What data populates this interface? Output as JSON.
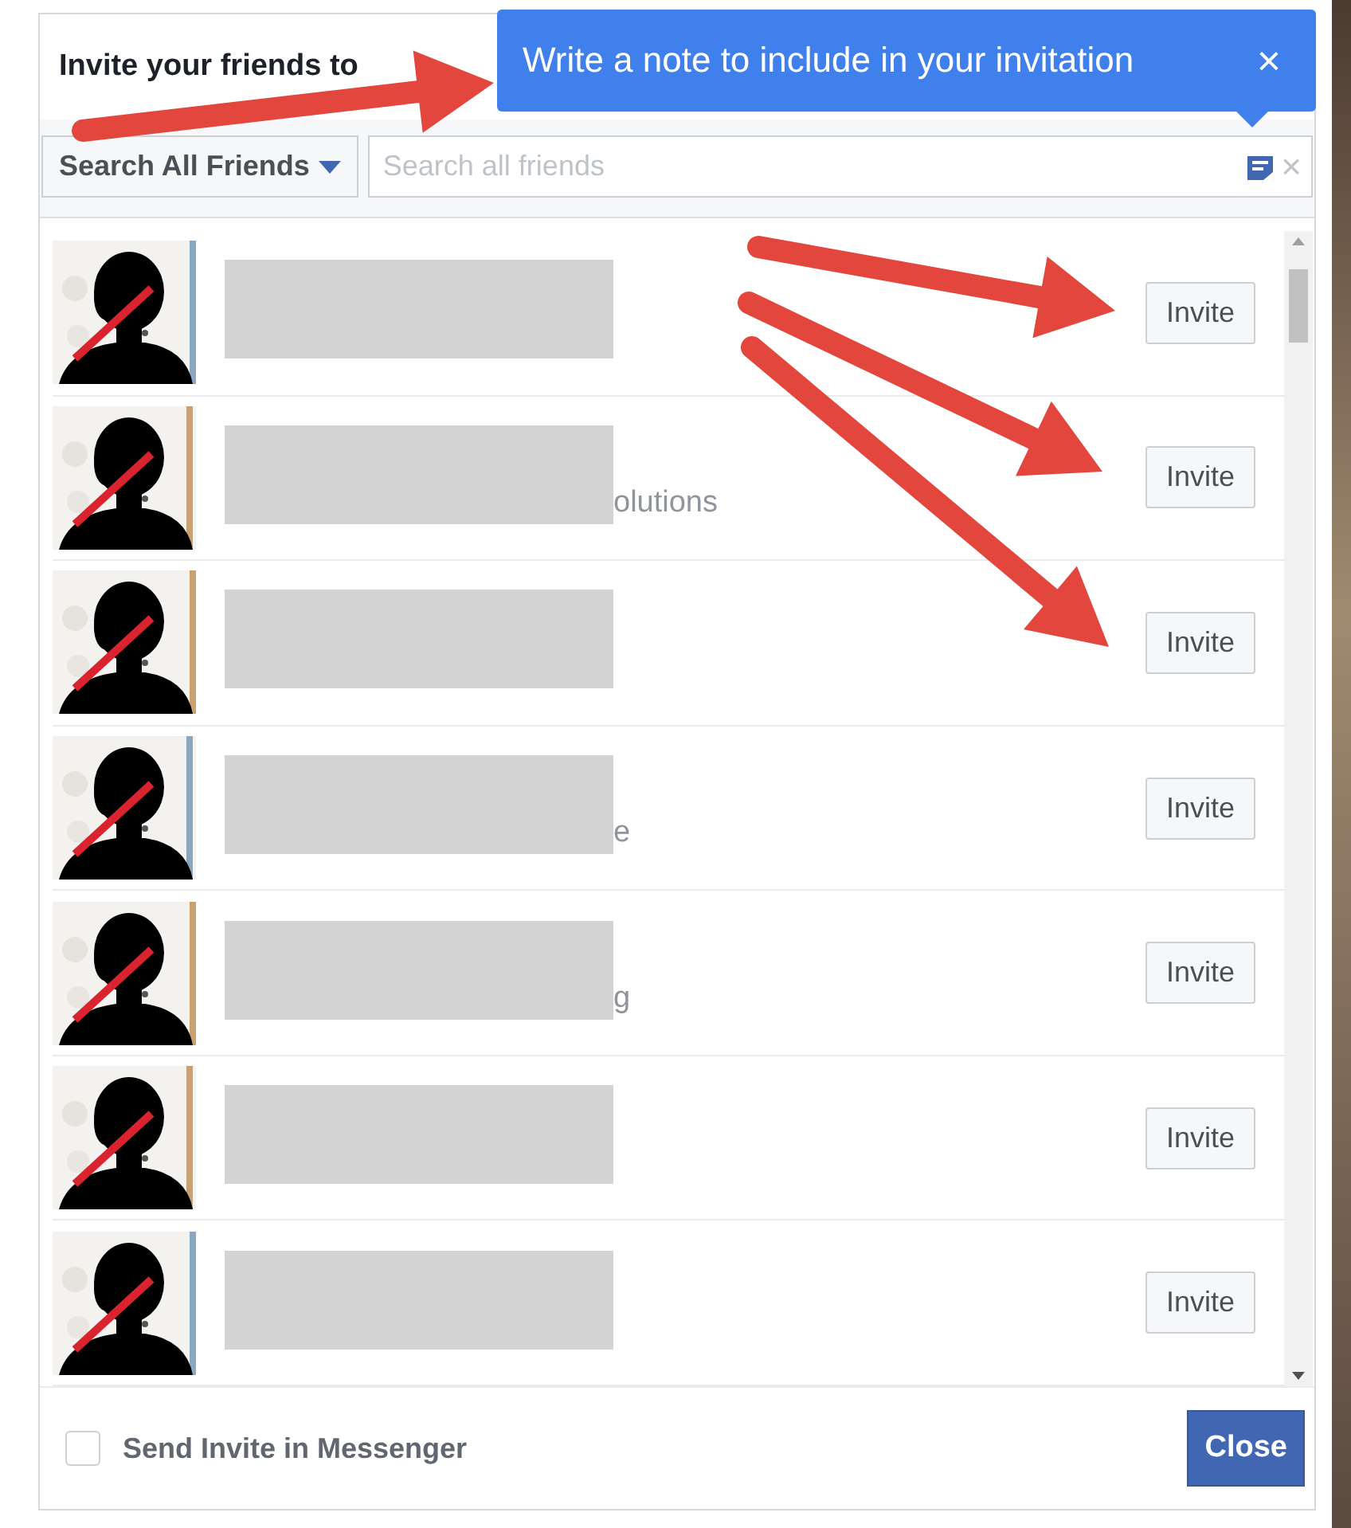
{
  "dialog": {
    "title": "Invite your friends to"
  },
  "tooltip": {
    "text": "Write a note to include in your invitation",
    "close": "×"
  },
  "search": {
    "scope": "Search All Friends",
    "placeholder": "Search all friends",
    "clear": "×"
  },
  "friends": [
    {
      "invite": "Invite"
    },
    {
      "invite": "Invite",
      "subtitle_fragment": "olutions"
    },
    {
      "invite": "Invite"
    },
    {
      "invite": "Invite",
      "subtitle_fragment": "e"
    },
    {
      "invite": "Invite",
      "subtitle_fragment": "g"
    },
    {
      "invite": "Invite"
    },
    {
      "invite": "Invite"
    }
  ],
  "footer": {
    "messenger": {
      "label": "Send Invite in Messenger",
      "checked": false
    },
    "close": "Close"
  }
}
